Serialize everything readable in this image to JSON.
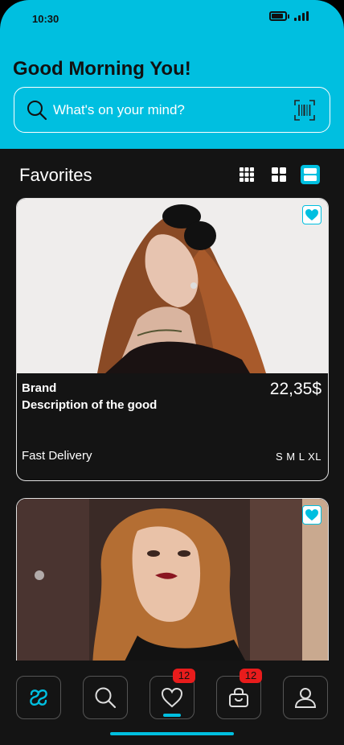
{
  "status_bar": {
    "time": "10:30"
  },
  "header": {
    "greeting": "Good Morning You!",
    "search_placeholder": "What's on your mind?"
  },
  "favorites": {
    "title": "Favorites",
    "view_modes": [
      "grid-small",
      "grid-large",
      "list"
    ],
    "active_view": "list"
  },
  "products": [
    {
      "brand": "Brand",
      "description": "Description of the good",
      "price": "22,35$",
      "delivery": "Fast Delivery",
      "sizes": "S M L XL",
      "favorited": true
    },
    {
      "favorited": true
    }
  ],
  "bottom_nav": {
    "items": [
      {
        "name": "home",
        "icon": "logo-icon"
      },
      {
        "name": "search",
        "icon": "search-icon"
      },
      {
        "name": "favorites",
        "icon": "heart-icon",
        "badge": "12",
        "active": true
      },
      {
        "name": "bag",
        "icon": "shopping-bag-icon",
        "badge": "12"
      },
      {
        "name": "profile",
        "icon": "user-icon"
      }
    ]
  },
  "colors": {
    "accent": "#00bfe0",
    "background": "#141414",
    "badge": "#e81c1c"
  }
}
